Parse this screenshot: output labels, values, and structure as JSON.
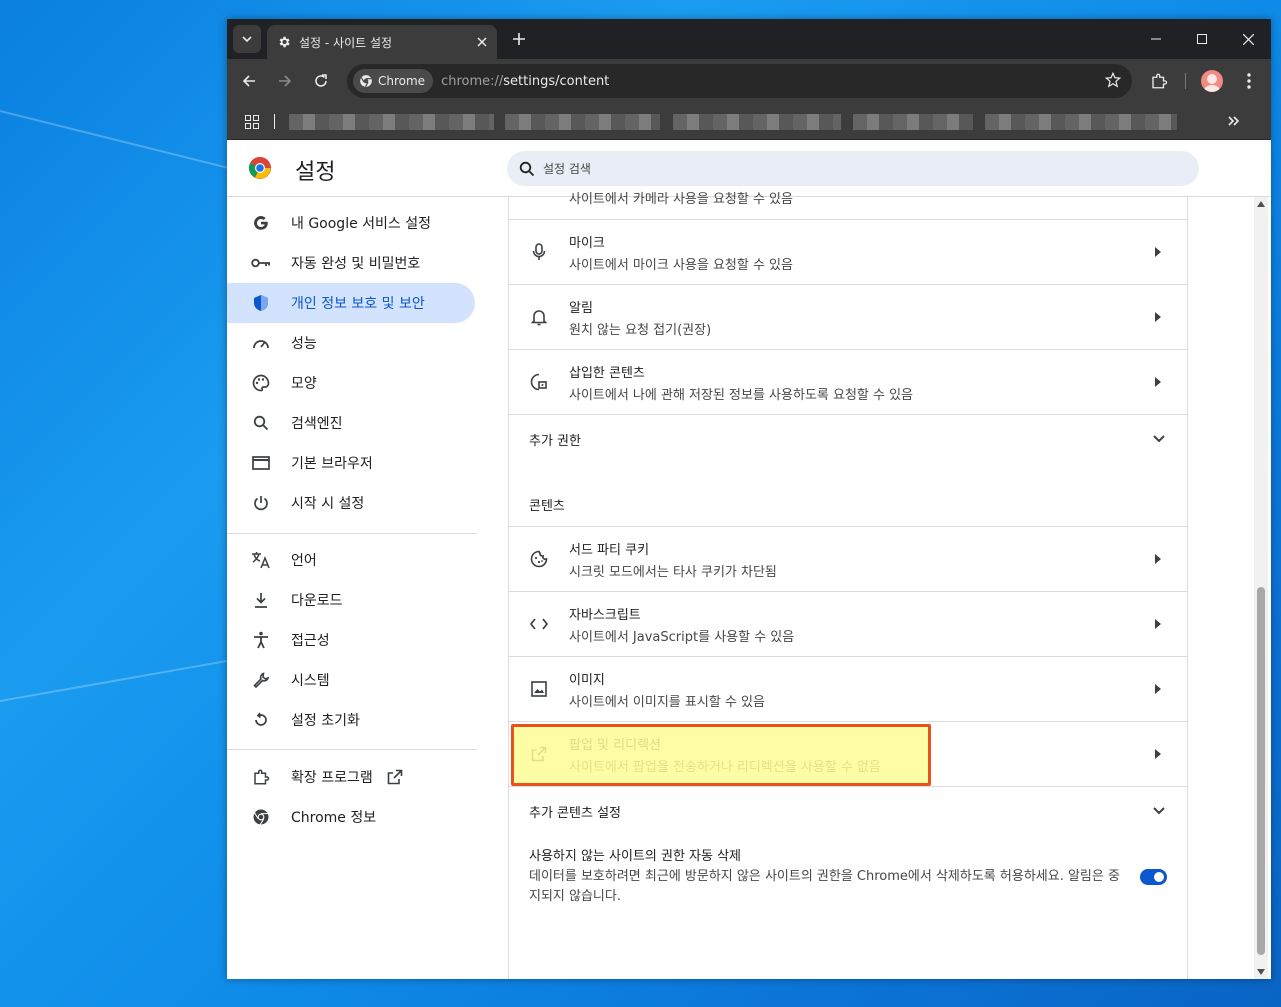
{
  "window": {
    "tab_title": "설정 - 사이트 설정",
    "url_chip": "Chrome",
    "url_prefix": "chrome://",
    "url_path": "settings/content"
  },
  "header": {
    "title": "설정",
    "search_placeholder": "설정 검색"
  },
  "sidebar": {
    "items": [
      {
        "label": "내 Google 서비스 설정",
        "icon": "google-g-icon"
      },
      {
        "label": "자동 완성 및 비밀번호",
        "icon": "key-icon"
      },
      {
        "label": "개인 정보 보호 및 보안",
        "icon": "shield-icon"
      },
      {
        "label": "성능",
        "icon": "speedometer-icon"
      },
      {
        "label": "모양",
        "icon": "palette-icon"
      },
      {
        "label": "검색엔진",
        "icon": "search-icon"
      },
      {
        "label": "기본 브라우저",
        "icon": "browser-window-icon"
      },
      {
        "label": "시작 시 설정",
        "icon": "power-icon"
      },
      {
        "label": "언어",
        "icon": "translate-icon"
      },
      {
        "label": "다운로드",
        "icon": "download-icon"
      },
      {
        "label": "접근성",
        "icon": "accessibility-icon"
      },
      {
        "label": "시스템",
        "icon": "wrench-icon"
      },
      {
        "label": "설정 초기화",
        "icon": "reset-icon"
      },
      {
        "label": "확장 프로그램",
        "icon": "extension-icon"
      },
      {
        "label": "Chrome 정보",
        "icon": "chrome-icon"
      }
    ]
  },
  "content": {
    "cut_off_text": "사이트에서 카메라 사용을 요청할 수 있음",
    "permissions": [
      {
        "title": "마이크",
        "desc": "사이트에서 마이크 사용을 요청할 수 있음",
        "icon": "microphone-icon"
      },
      {
        "title": "알림",
        "desc": "원치 않는 요청 접기(권장)",
        "icon": "bell-icon"
      },
      {
        "title": "삽입한 콘텐츠",
        "desc": "사이트에서 나에 관해 저장된 정보를 사용하도록 요청할 수 있음",
        "icon": "embedded-content-icon"
      }
    ],
    "more_permissions": "추가 권한",
    "content_heading": "콘텐츠",
    "content_items": [
      {
        "title": "서드 파티 쿠키",
        "desc": "시크릿 모드에서는 타사 쿠키가 차단됨",
        "icon": "cookie-icon"
      },
      {
        "title": "자바스크립트",
        "desc": "사이트에서 JavaScript를 사용할 수 있음",
        "icon": "code-icon"
      },
      {
        "title": "이미지",
        "desc": "사이트에서 이미지를 표시할 수 있음",
        "icon": "image-icon"
      },
      {
        "title": "팝업 및 리디렉션",
        "desc": "사이트에서 팝업을 전송하거나 리디렉션을 사용할 수 없음",
        "icon": "open-in-new-icon"
      }
    ],
    "more_content": "추가 콘텐츠 설정",
    "auto_revoke": {
      "title": "사용하지 않는 사이트의 권한 자동 삭제",
      "desc": "데이터를 보호하려면 최근에 방문하지 않은 사이트의 권한을 Chrome에서 삭제하도록 허용하세요. 알림은 중지되지 않습니다.",
      "enabled": true
    }
  },
  "colors": {
    "accent": "#0b57d0",
    "active_nav_bg": "#d3e3fd",
    "highlight_border": "#e8531c"
  }
}
